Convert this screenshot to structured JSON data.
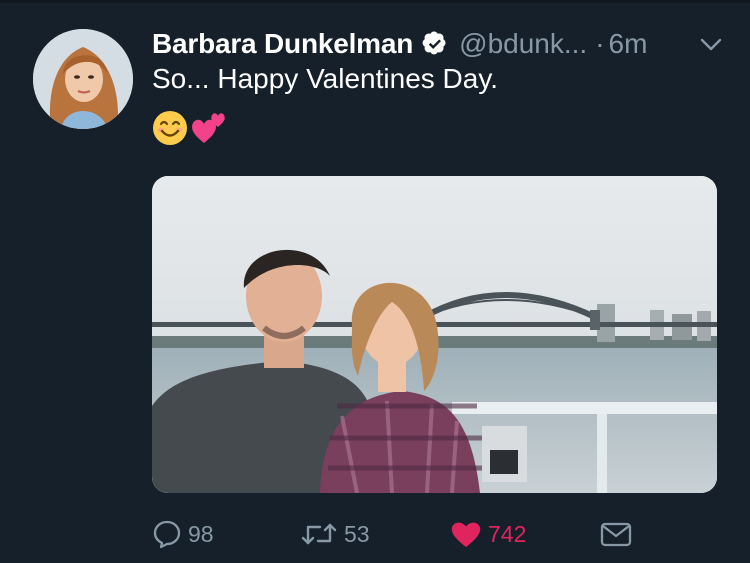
{
  "tweet": {
    "author_name": "Barbara Dunkelman",
    "handle": "@bdunk...",
    "separator": "·",
    "time": "6m",
    "text": "So... Happy Valentines Day.",
    "emojis": [
      "smiling-face-emoji",
      "two-hearts-emoji"
    ],
    "verified_icon": "verified-badge-icon",
    "menu_icon": "chevron-down-icon"
  },
  "actions": {
    "reply_count": "98",
    "retweet_count": "53",
    "like_count": "742"
  },
  "icons": {
    "reply": "reply-bubble-icon",
    "retweet": "retweet-icon",
    "like": "heart-icon",
    "dm": "envelope-icon"
  },
  "colors": {
    "background": "#15202b",
    "muted_text": "#8899a6",
    "accent_blue": "#1da1f2",
    "like_pink": "#e0245e"
  }
}
